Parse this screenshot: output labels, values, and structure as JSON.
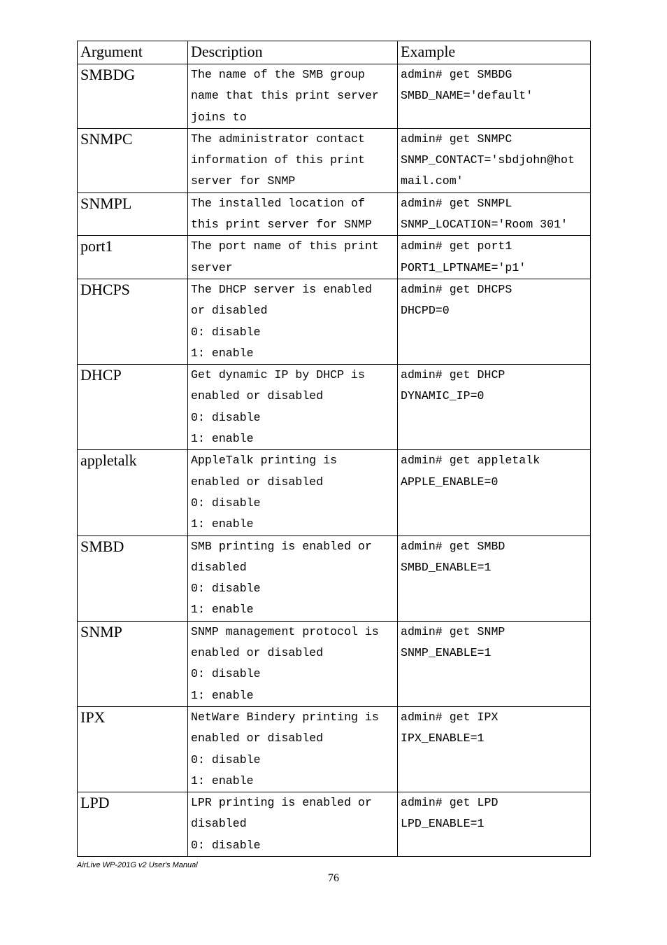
{
  "headers": {
    "c1": "Argument",
    "c2": "Description",
    "c3": "Example"
  },
  "rows": [
    {
      "arg": "SMBDG",
      "desc": [
        "The name of the SMB group",
        "name that this print server",
        "joins to"
      ],
      "ex": [
        "admin# get SMBDG",
        "SMBD_NAME='default'",
        ""
      ]
    },
    {
      "arg": "SNMPC",
      "desc": [
        "The administrator contact",
        "information of this print",
        "server for SNMP"
      ],
      "ex": [
        "admin# get SNMPC",
        "SNMP_CONTACT='sbdjohn@hot",
        "mail.com'"
      ]
    },
    {
      "arg": "SNMPL",
      "desc": [
        "The installed location of",
        "this print server for SNMP"
      ],
      "ex": [
        "admin# get SNMPL",
        "SNMP_LOCATION='Room 301'"
      ]
    },
    {
      "arg": "port1",
      "desc": [
        "The port name of this print",
        "server"
      ],
      "ex": [
        "admin# get port1",
        "PORT1_LPTNAME='p1'"
      ]
    },
    {
      "arg": "DHCPS",
      "desc": [
        "The DHCP server is enabled",
        "or disabled",
        "0: disable",
        "1: enable"
      ],
      "ex": [
        "admin# get DHCPS",
        "DHCPD=0",
        "",
        ""
      ]
    },
    {
      "arg": "DHCP",
      "desc": [
        "Get dynamic IP by DHCP is",
        "enabled or disabled",
        "0: disable",
        "1: enable"
      ],
      "ex": [
        "admin# get DHCP",
        "DYNAMIC_IP=0",
        "",
        ""
      ]
    },
    {
      "arg": "appletalk",
      "desc": [
        "AppleTalk printing is",
        "enabled or disabled",
        "0: disable",
        "1: enable"
      ],
      "ex": [
        "admin# get appletalk",
        "APPLE_ENABLE=0",
        "",
        ""
      ]
    },
    {
      "arg": "SMBD",
      "desc": [
        "SMB printing is enabled or",
        "disabled",
        "0: disable",
        "1: enable"
      ],
      "ex": [
        "admin# get SMBD",
        "SMBD_ENABLE=1",
        "",
        ""
      ]
    },
    {
      "arg": "SNMP",
      "desc": [
        "SNMP management protocol is",
        "enabled or disabled",
        "0: disable",
        "1: enable"
      ],
      "ex": [
        "admin# get SNMP",
        "SNMP_ENABLE=1",
        "",
        ""
      ]
    },
    {
      "arg": "IPX",
      "desc": [
        "NetWare Bindery printing is",
        "enabled or disabled",
        "0: disable",
        "1: enable"
      ],
      "ex": [
        "admin# get IPX",
        "IPX_ENABLE=1",
        "",
        ""
      ]
    },
    {
      "arg": "LPD",
      "desc": [
        "LPR printing is enabled or",
        "disabled",
        "0: disable"
      ],
      "ex": [
        "admin# get LPD",
        "LPD_ENABLE=1",
        ""
      ]
    }
  ],
  "footer": "AirLive WP-201G v2 User's Manual",
  "page_number": "76"
}
